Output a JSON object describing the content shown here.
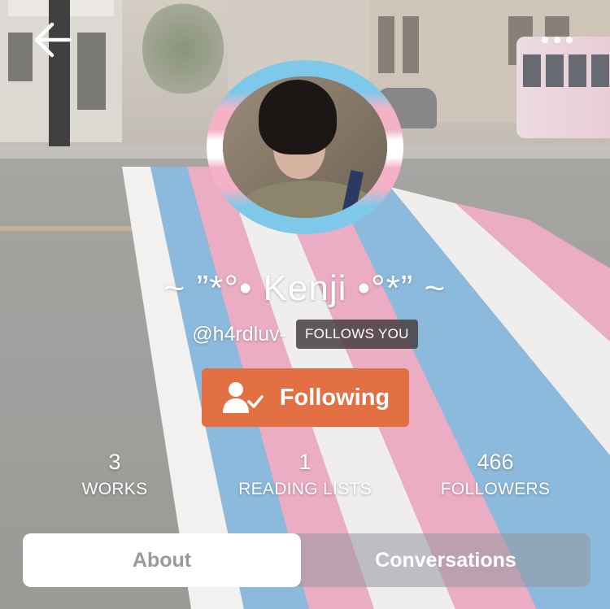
{
  "top_bar": {
    "back_icon": "arrow-left-icon",
    "more_icon": "ellipsis-icon"
  },
  "profile": {
    "display_name": "~ ”*°• Kenji •°*” ~",
    "handle": "@h4rdluv-",
    "follows_you_badge": "FOLLOWS YOU",
    "avatar_ring_colors": [
      "#7ec8ea",
      "#f3b2c5",
      "#ffffff"
    ]
  },
  "follow_button": {
    "label": "Following",
    "icon": "user-check-icon",
    "color": "#e37043"
  },
  "stats": [
    {
      "value": "3",
      "label": "WORKS"
    },
    {
      "value": "1",
      "label": "READING LISTS"
    },
    {
      "value": "466",
      "label": "FOLLOWERS"
    }
  ],
  "tabs": [
    {
      "label": "About",
      "active": true
    },
    {
      "label": "Conversations",
      "active": false
    }
  ]
}
